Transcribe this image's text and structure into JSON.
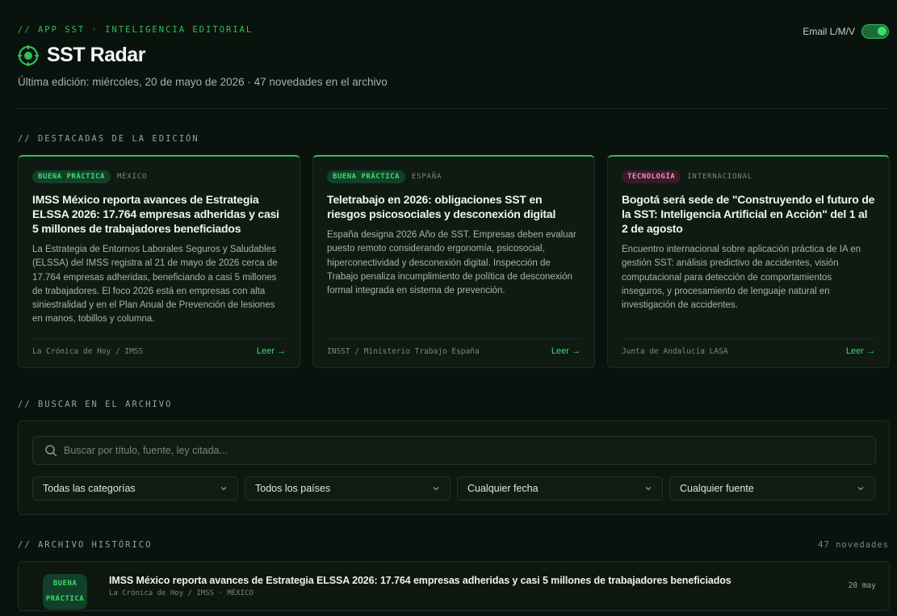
{
  "header": {
    "eyebrow": "// APP SST · INTELIGENCIA EDITORIAL",
    "title": "SST Radar",
    "logo_icon": "radar-target-icon",
    "subtitle": "Última edición: miércoles, 20 de mayo de 2026 · 47 novedades en el archivo",
    "email_toggle": {
      "label": "Email L/M/V",
      "enabled": true
    }
  },
  "featured": {
    "heading": "// DESTACADAS DE LA EDICIÓN",
    "cards": [
      {
        "category": "BUENA PRÁCTICA",
        "country": "MÉXICO",
        "title": "IMSS México reporta avances de Estrategia ELSSA 2026: 17.764 empresas adheridas y casi 5 millones de trabajadores beneficiados",
        "body": "La Estrategia de Entornos Laborales Seguros y Saludables (ELSSA) del IMSS registra al 21 de mayo de 2026 cerca de 17.764 empresas adheridas, beneficiando a casi 5 millones de trabajadores. El foco 2026 está en empresas con alta siniestralidad y en el Plan Anual de Prevención de lesiones en manos, tobillos y columna.",
        "source": "La Crónica de Hoy / IMSS",
        "read_label": "Leer →"
      },
      {
        "category": "BUENA PRÁCTICA",
        "country": "ESPAÑA",
        "title": "Teletrabajo en 2026: obligaciones SST en riesgos psicosociales y desconexión digital",
        "body": "España designa 2026 Año de SST. Empresas deben evaluar puesto remoto considerando ergonomía, psicosocial, hiperconectividad y desconexión digital. Inspección de Trabajo penaliza incumplimiento de política de desconexión formal integrada en sistema de prevención.",
        "source": "INSST / Ministerio Trabajo España",
        "read_label": "Leer →"
      },
      {
        "category": "TECNOLOGÍA",
        "country": "INTERNACIONAL",
        "title": "Bogotá será sede de \"Construyendo el futuro de la SST: Inteligencia Artificial en Acción\" del 1 al 2 de agosto",
        "body": "Encuentro internacional sobre aplicación práctica de IA en gestión SST: análisis predictivo de accidentes, visión computacional para detección de comportamientos inseguros, y procesamiento de lenguaje natural en investigación de accidentes.",
        "source": "Junta de Andalucía LASA",
        "read_label": "Leer →"
      }
    ]
  },
  "search": {
    "heading": "// BUSCAR EN EL ARCHIVO",
    "placeholder": "Buscar por título, fuente, ley citada...",
    "filters": [
      {
        "value": "Todas las categorías"
      },
      {
        "value": "Todos los países"
      },
      {
        "value": "Cualquier fecha"
      },
      {
        "value": "Cualquier fuente"
      }
    ]
  },
  "archive": {
    "heading": "// ARCHIVO HISTÓRICO",
    "count": "47 novedades",
    "items": [
      {
        "category": "BUENA PRÁCTICA",
        "title": "IMSS México reporta avances de Estrategia ELSSA 2026: 17.764 empresas adheridas y casi 5 millones de trabajadores beneficiados",
        "meta": "La Crónica de Hoy / IMSS · MÉXICO",
        "date": "20 may"
      }
    ]
  },
  "colors": {
    "background": "#0a120d",
    "accent": "#2fbf5a",
    "tag_green_text": "#3ddc6a",
    "tag_pink_text": "#f28fb8"
  }
}
